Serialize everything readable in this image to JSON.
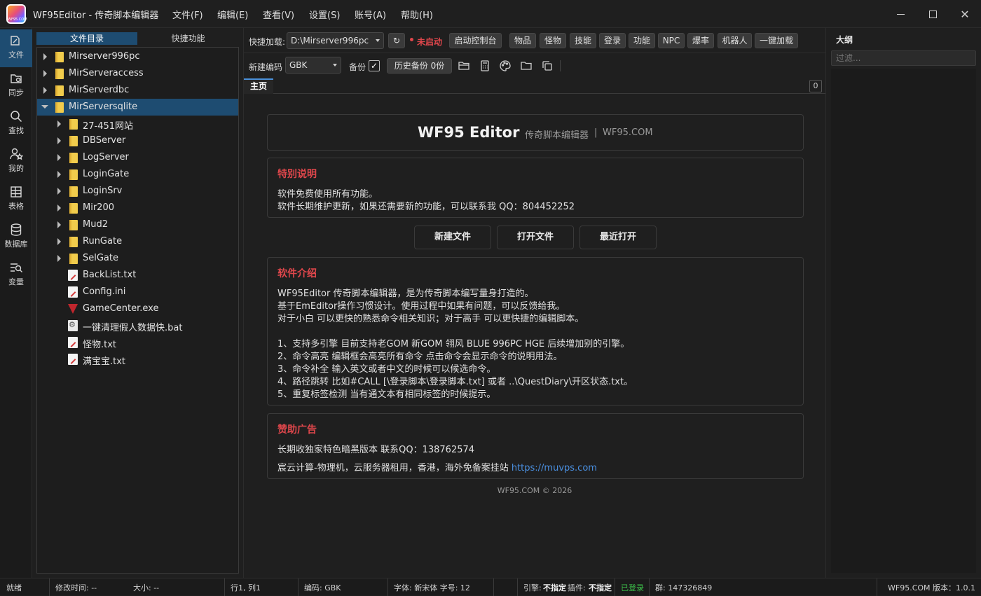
{
  "app": {
    "title": "WF95Editor - 传奇脚本编辑器",
    "logo_text": "WF95.COM"
  },
  "menu": [
    "文件(F)",
    "编辑(E)",
    "查看(V)",
    "设置(S)",
    "账号(A)",
    "帮助(H)"
  ],
  "activity": [
    {
      "label": "文件",
      "icon": "file-icon"
    },
    {
      "label": "同步",
      "icon": "sync-icon"
    },
    {
      "label": "查找",
      "icon": "search-icon"
    },
    {
      "label": "我的",
      "icon": "user-icon"
    },
    {
      "label": "表格",
      "icon": "table-icon"
    },
    {
      "label": "数据库",
      "icon": "database-icon"
    },
    {
      "label": "变量",
      "icon": "variable-icon"
    }
  ],
  "panel_tabs": [
    "文件目录",
    "快捷功能"
  ],
  "tree": [
    {
      "label": "Mirserver996pc",
      "type": "folder",
      "level": 0,
      "expanded": false
    },
    {
      "label": "MirServeraccess",
      "type": "folder",
      "level": 0,
      "expanded": false
    },
    {
      "label": "MirServerdbc",
      "type": "folder",
      "level": 0,
      "expanded": false
    },
    {
      "label": "MirServersqlite",
      "type": "folder",
      "level": 0,
      "expanded": true,
      "selected": true
    },
    {
      "label": "27-451网站",
      "type": "folder",
      "level": 1,
      "expanded": false
    },
    {
      "label": "DBServer",
      "type": "folder",
      "level": 1,
      "expanded": false
    },
    {
      "label": "LogServer",
      "type": "folder",
      "level": 1,
      "expanded": false
    },
    {
      "label": "LoginGate",
      "type": "folder",
      "level": 1,
      "expanded": false
    },
    {
      "label": "LoginSrv",
      "type": "folder",
      "level": 1,
      "expanded": false
    },
    {
      "label": "Mir200",
      "type": "folder",
      "level": 1,
      "expanded": false
    },
    {
      "label": "Mud2",
      "type": "folder",
      "level": 1,
      "expanded": false
    },
    {
      "label": "RunGate",
      "type": "folder",
      "level": 1,
      "expanded": false
    },
    {
      "label": "SelGate",
      "type": "folder",
      "level": 1,
      "expanded": false
    },
    {
      "label": "BackList.txt",
      "type": "txt",
      "level": 1
    },
    {
      "label": "Config.ini",
      "type": "ini",
      "level": 1
    },
    {
      "label": "GameCenter.exe",
      "type": "exe",
      "level": 1
    },
    {
      "label": "一键清理假人数据快.bat",
      "type": "bat",
      "level": 1
    },
    {
      "label": "怪物.txt",
      "type": "txt",
      "level": 1
    },
    {
      "label": "满宝宝.txt",
      "type": "txt",
      "level": 1
    }
  ],
  "toolbar1": {
    "quick_load_label": "快捷加载:",
    "path_value": "D:\\Mirserver996pc",
    "refresh": "↻",
    "status": "未启动",
    "status_color": "#e0474c",
    "console_btn": "启动控制台",
    "buttons": [
      "物品",
      "怪物",
      "技能",
      "登录",
      "功能",
      "NPC",
      "爆率",
      "机器人",
      "一键加载"
    ]
  },
  "toolbar2": {
    "encoding_label": "新建编码",
    "encoding_value": "GBK",
    "backup_label": "备份",
    "backup_checked": true,
    "history_btn": "历史备份 0份"
  },
  "tabs": {
    "home": "主页",
    "count": "0"
  },
  "header_card": {
    "title": "WF95 Editor",
    "subtitle": "传奇脚本编辑器",
    "sep": "|",
    "site": "WF95.COM"
  },
  "special": {
    "heading": "特别说明",
    "lines": [
      "软件免费使用所有功能。",
      "软件长期维护更新，如果还需要新的功能，可以联系我 QQ：804452252"
    ]
  },
  "actions": [
    "新建文件",
    "打开文件",
    "最近打开"
  ],
  "intro": {
    "heading": "软件介绍",
    "lines": [
      "WF95Editor 传奇脚本编辑器，是为传奇脚本编写量身打造的。",
      "基于EmEditor操作习惯设计。使用过程中如果有问题，可以反馈给我。",
      "对于小白 可以更快的熟悉命令相关知识；对于高手 可以更快捷的编辑脚本。",
      "1、支持多引擎 目前支持老GOM 新GOM 翎风 BLUE 996PC HGE 后续增加别的引擎。",
      "2、命令高亮 编辑框会高亮所有命令 点击命令会显示命令的说明用法。",
      "3、命令补全 输入英文或者中文的时候可以候选命令。",
      "4、路径跳转 比如#CALL [\\登录脚本\\登录脚本.txt] 或者 ..\\QuestDiary\\开区状态.txt。",
      "5、重复标签检测 当有通文本有相同标签的时候提示。"
    ]
  },
  "sponsor": {
    "heading": "赞助广告",
    "line1": "长期收独家特色暗黑版本 联系QQ：138762574",
    "line2": "宸云计算-物理机，云服务器租用，香港，海外免备案挂站 ",
    "link": "https://muvps.com",
    "link_color": "#4a8fe0"
  },
  "footer": "WF95.COM © 2026",
  "outline": {
    "title": "大纲",
    "filter_placeholder": "过滤..."
  },
  "status": {
    "ready": "就绪",
    "modified": "修改时间: --",
    "size": "大小: --",
    "position": "行1, 列1",
    "encoding": "编码: GBK",
    "font": "字体: 新宋体  字号: 12",
    "engine_label": "引擎:",
    "engine_value": "不指定",
    "plugin_label": "插件:",
    "plugin_value": "不指定",
    "login": "已登录",
    "login_color": "#3cbf4a",
    "group": "群:  147326849",
    "version": "WF95.COM  版本：1.0.1"
  },
  "colors": {
    "accent": "#1e4c71",
    "heading_red": "#e0474c"
  }
}
